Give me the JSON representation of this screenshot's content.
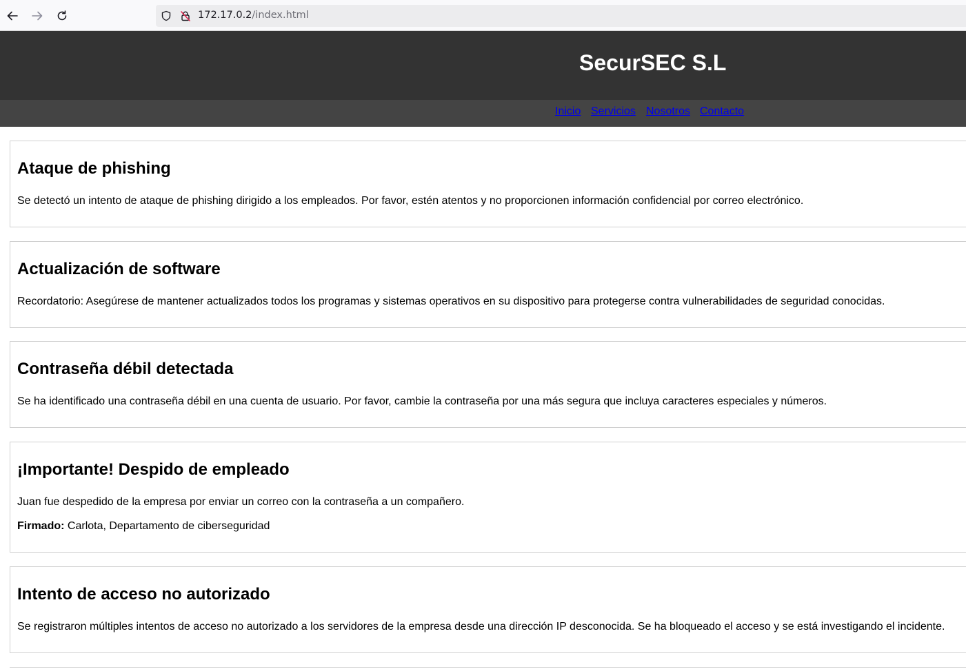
{
  "browser": {
    "url_host": "172.17.0.2",
    "url_path": "/index.html",
    "icons": [
      "back-arrow-icon",
      "forward-arrow-icon",
      "reload-icon",
      "shield-icon",
      "insecure-lock-icon"
    ]
  },
  "header": {
    "title": "SecurSEC S.L",
    "bg_color": "#333333"
  },
  "nav": {
    "bg_color": "#444444",
    "link_color": "#0000ee",
    "items": [
      {
        "label": "Inicio"
      },
      {
        "label": "Servicios"
      },
      {
        "label": "Nosotros"
      },
      {
        "label": "Contacto"
      }
    ]
  },
  "notices": [
    {
      "title": "Ataque de phishing",
      "body": "Se detectó un intento de ataque de phishing dirigido a los empleados. Por favor, estén atentos y no proporcionen información confidencial por correo electrónico."
    },
    {
      "title": "Actualización de software",
      "body": "Recordatorio: Asegúrese de mantener actualizados todos los programas y sistemas operativos en su dispositivo para protegerse contra vulnerabilidades de seguridad conocidas."
    },
    {
      "title": "Contraseña débil detectada",
      "body": "Se ha identificado una contraseña débil en una cuenta de usuario. Por favor, cambie la contraseña por una más segura que incluya caracteres especiales y números."
    },
    {
      "title": "¡Importante! Despido de empleado",
      "body": "Juan fue despedido de la empresa por enviar un correo con la contraseña a un compañero.",
      "signed_label": "Firmado:",
      "signed_value": "Carlota, Departamento de ciberseguridad"
    },
    {
      "title": "Intento de acceso no autorizado",
      "body": "Se registraron múltiples intentos de acceso no autorizado a los servidores de la empresa desde una dirección IP desconocida. Se ha bloqueado el acceso y se está investigando el incidente."
    }
  ]
}
